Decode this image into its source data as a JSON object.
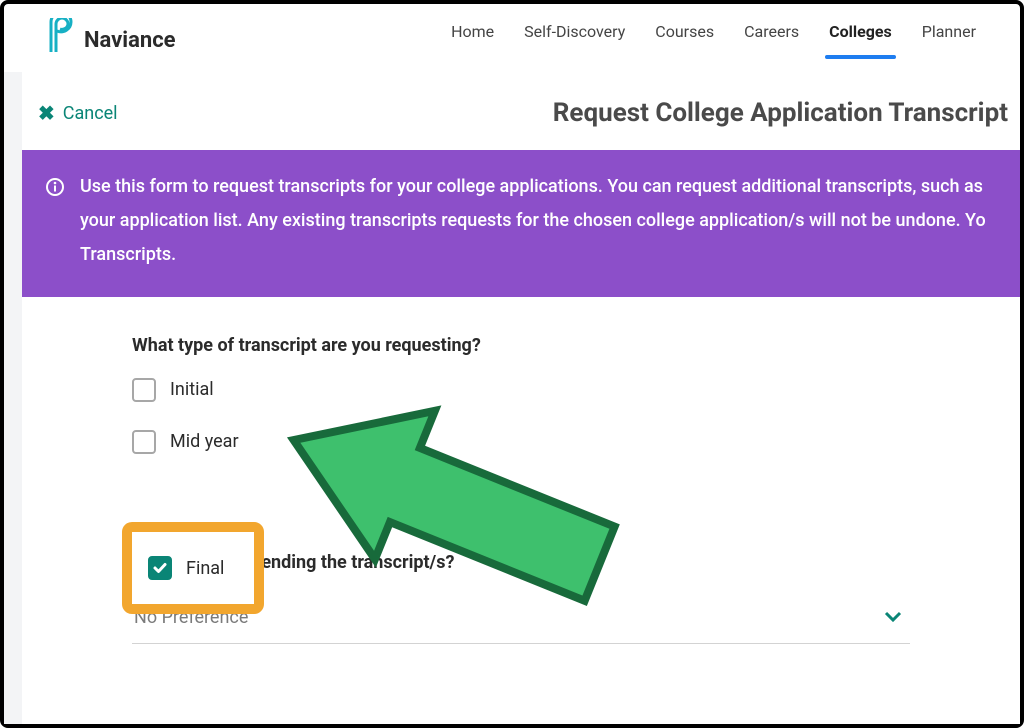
{
  "brand": {
    "name": "Naviance"
  },
  "nav": {
    "items": [
      "Home",
      "Self-Discovery",
      "Courses",
      "Careers",
      "Colleges",
      "Planner"
    ],
    "active_index": 4
  },
  "cancel_label": "Cancel",
  "page_title": "Request College Application Transcript",
  "banner": {
    "line1": "Use this form to request transcripts for your college applications. You can request additional transcripts, such as",
    "line2": "your application list. Any existing transcripts requests for the chosen college application/s will not be undone. Yo",
    "line3": "Transcripts."
  },
  "form": {
    "question1": "What type of transcript are you requesting?",
    "options": [
      {
        "label": "Initial",
        "checked": false
      },
      {
        "label": "Mid year",
        "checked": false
      },
      {
        "label": "Final",
        "checked": true
      }
    ],
    "question2": "Where are you sending the transcript/s?",
    "select_placeholder": "No Preference"
  },
  "colors": {
    "accent_teal": "#0a8576",
    "banner_purple": "#8c4fc9",
    "highlight_orange": "#f2a62e",
    "arrow_green": "#3ec06d",
    "arrow_border": "#186a3b",
    "active_blue": "#1e7df0"
  }
}
